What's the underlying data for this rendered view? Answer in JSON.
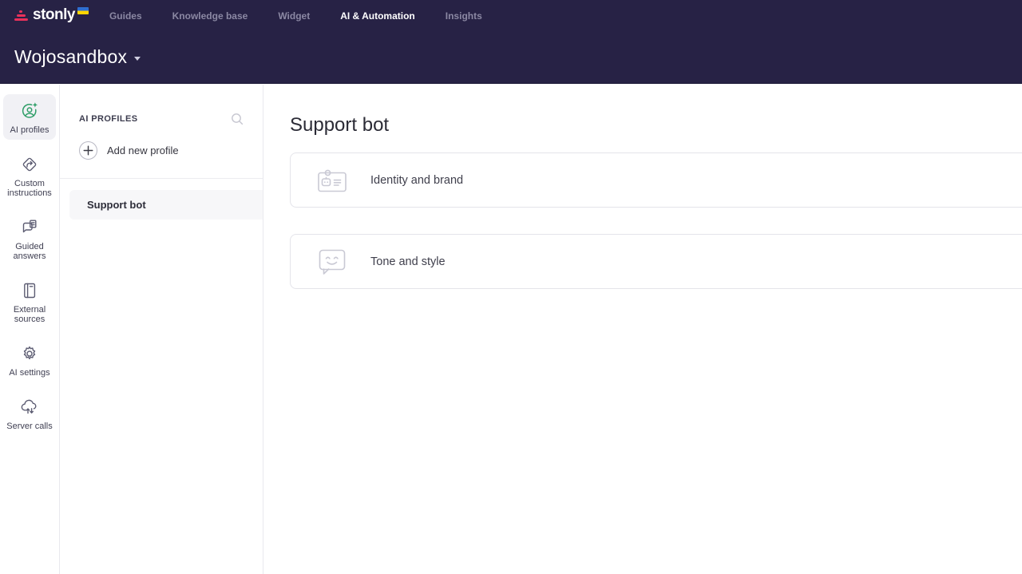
{
  "header": {
    "logo_text": "stonly",
    "nav": [
      {
        "label": "Guides",
        "active": false
      },
      {
        "label": "Knowledge base",
        "active": false
      },
      {
        "label": "Widget",
        "active": false
      },
      {
        "label": "AI & Automation",
        "active": true
      },
      {
        "label": "Insights",
        "active": false
      }
    ],
    "workspace": {
      "name": "Wojosandbox"
    }
  },
  "sidebar": {
    "items": [
      {
        "label": "AI profiles",
        "icon": "ai-profiles-icon",
        "active": true
      },
      {
        "label": "Custom instructions",
        "icon": "custom-instructions-icon",
        "active": false
      },
      {
        "label": "Guided answers",
        "icon": "guided-answers-icon",
        "active": false
      },
      {
        "label": "External sources",
        "icon": "external-sources-icon",
        "active": false
      },
      {
        "label": "AI settings",
        "icon": "ai-settings-icon",
        "active": false
      },
      {
        "label": "Server calls",
        "icon": "server-calls-icon",
        "active": false
      }
    ]
  },
  "profiles_panel": {
    "title": "AI PROFILES",
    "search_icon": "search-icon",
    "add_button_label": "Add new profile",
    "items": [
      {
        "name": "Support bot",
        "selected": true
      }
    ]
  },
  "main": {
    "title": "Support bot",
    "cards": [
      {
        "label": "Identity and brand",
        "icon": "identity-badge-icon"
      },
      {
        "label": "Tone and style",
        "icon": "tone-smiley-bubble-icon"
      }
    ]
  },
  "colors": {
    "header_bg": "#272245",
    "brand_pink": "#e8315b",
    "accent_green": "#2f9e68",
    "nav_inactive": "#8b88a3",
    "nav_active": "#ffffff",
    "flag_blue": "#2f6fd0",
    "flag_yellow": "#ffd500",
    "card_border": "#e4e4ea",
    "selected_row_bg": "#f7f7f9"
  }
}
